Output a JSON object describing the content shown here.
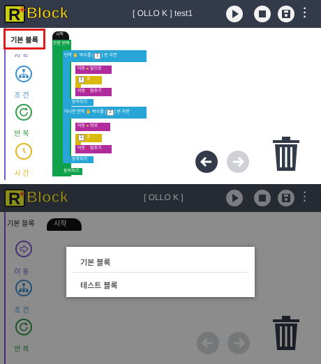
{
  "colors": {
    "topbar": "#333a4a",
    "accent_red": "#e21b1b",
    "loop_green": "#10a24a",
    "cond_blue": "#26a5d6",
    "motion_purple": "#b02b9c",
    "wait_yellow": "#d8b90c"
  },
  "app": {
    "logo_letter": "R",
    "logo_plus": "+",
    "logo_word": "Block"
  },
  "panel1": {
    "title": "[ OLLO K ]  test1",
    "sidebar": {
      "active_tab": "기본 블록",
      "items": [
        {
          "label": "이 동",
          "icon": "motion-icon"
        },
        {
          "label": "조 건",
          "icon": "condition-icon"
        },
        {
          "label": "반 복",
          "icon": "loop-icon"
        },
        {
          "label": "시 간",
          "icon": "time-icon"
        }
      ]
    },
    "blocks": {
      "start": "시작",
      "forever": "무한 반복",
      "if_text_a": "만약",
      "if_text_b": "박수를 (",
      "if_val": "1",
      "if_text_c": ") 번 치면",
      "move1_a": "이동",
      "move1_b": "앞으로",
      "wait1_val": "1",
      "wait1_unit": "초",
      "stop1_a": "이동",
      "stop1_b": "멈추기",
      "action1": "동작하기",
      "elif_text_a": "아니면 만약",
      "elif_text_b": "박수를 (",
      "elif_val": "2",
      "elif_text_c": ") 번 치면",
      "move2_a": "이동",
      "move2_b": "뒤로",
      "wait2_val": "1",
      "wait2_unit": "초",
      "stop2_a": "이동",
      "stop2_b": "멈추기",
      "action2": "동작하기",
      "action3": "동작하기"
    }
  },
  "panel2": {
    "title": "[ OLLO K ]",
    "sidebar": {
      "active_tab": "기본 블록",
      "items": [
        {
          "label": "이 동",
          "icon": "motion-icon"
        },
        {
          "label": "조 건",
          "icon": "condition-icon"
        },
        {
          "label": "반 복",
          "icon": "loop-icon"
        }
      ]
    },
    "start_block": "시작",
    "menu": {
      "items": [
        "기본 블록",
        "테스트 블록"
      ]
    }
  }
}
